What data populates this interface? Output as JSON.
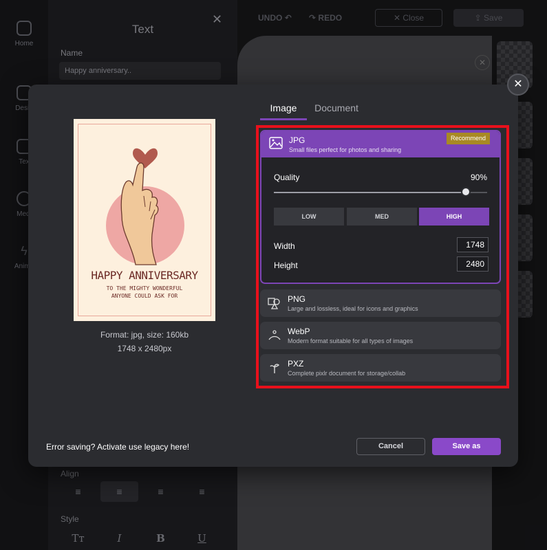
{
  "background": {
    "rail": {
      "items": [
        {
          "label": "Home"
        },
        {
          "label": "Desig"
        },
        {
          "label": "Tex"
        },
        {
          "label": "Medi"
        },
        {
          "label": "Anima"
        }
      ]
    },
    "text_panel": {
      "title": "Text",
      "close_glyph": "✕",
      "name_label": "Name",
      "name_value": "Happy anniversary..",
      "align_label": "Align",
      "style_label": "Style",
      "style_buttons": [
        "Tт",
        "I",
        "B",
        "U"
      ]
    },
    "topbar": {
      "undo_label": "UNDO",
      "redo_label": "REDO",
      "close_label": "Close",
      "save_label": "Save"
    }
  },
  "dialog": {
    "close_glyph": "✕",
    "preview": {
      "card_title": "HAPPY ANNIVERSARY",
      "card_line1": "TO THE MIGHTY WONDERFUL",
      "card_line2": "ANYONE COULD ASK FOR",
      "format_line": "Format: jpg, size: 160kb",
      "size_line": "1748 x 2480px"
    },
    "tabs": [
      {
        "label": "Image",
        "active": true
      },
      {
        "label": "Document",
        "active": false
      }
    ],
    "formats": {
      "jpg": {
        "name": "JPG",
        "desc": "Small files perfect for photos and sharing",
        "badge": "Recommend",
        "quality_label": "Quality",
        "quality_value": "90%",
        "quality_fraction": 0.9,
        "quality_buttons": [
          {
            "label": "LOW",
            "selected": false
          },
          {
            "label": "MED",
            "selected": false
          },
          {
            "label": "HIGH",
            "selected": true
          }
        ],
        "width_label": "Width",
        "width_value": "1748",
        "height_label": "Height",
        "height_value": "2480"
      },
      "png": {
        "name": "PNG",
        "desc": "Large and lossless, ideal for icons and graphics"
      },
      "webp": {
        "name": "WebP",
        "desc": "Modern format suitable for all types of images"
      },
      "pxz": {
        "name": "PXZ",
        "desc": "Complete pixlr document for storage/collab"
      }
    },
    "footer": {
      "legacy_text": "Error saving? Activate use legacy here!",
      "cancel_label": "Cancel",
      "save_as_label": "Save as"
    }
  },
  "colors": {
    "accent": "#7c45b6",
    "highlight_box": "#e8101b",
    "badge": "#a88924"
  }
}
